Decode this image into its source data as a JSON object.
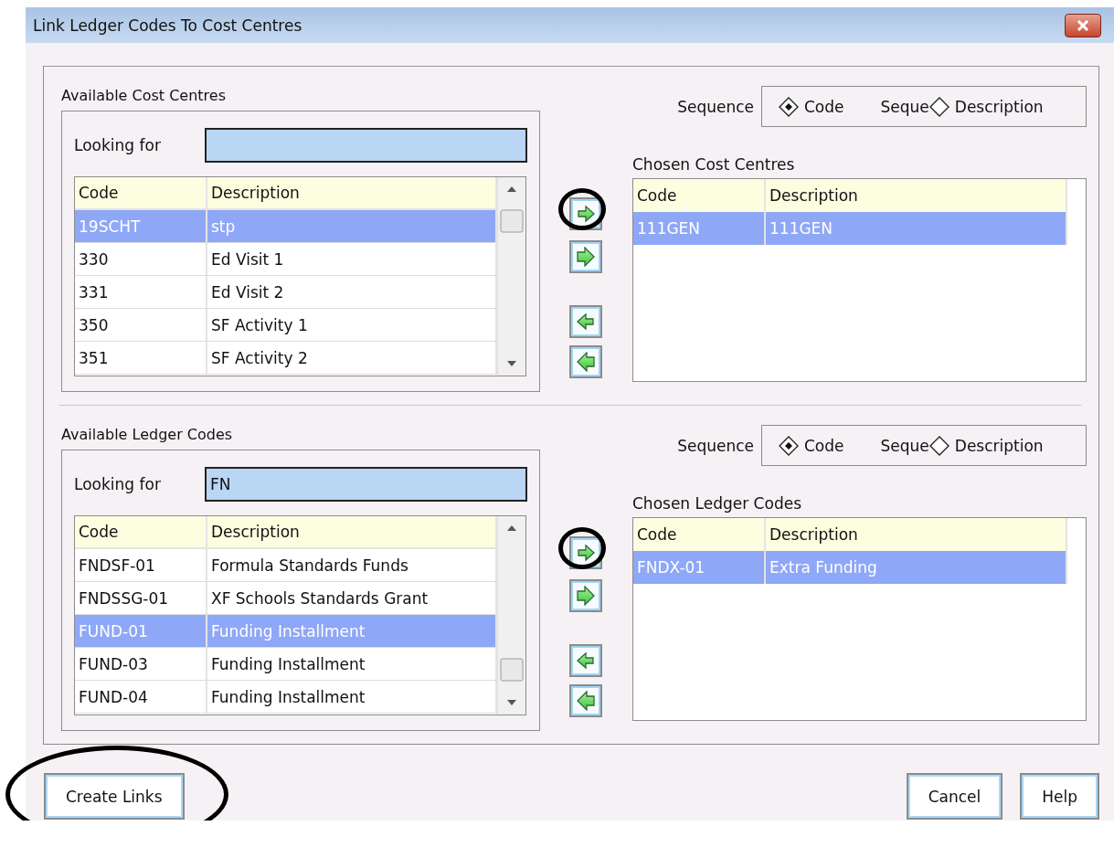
{
  "window": {
    "title": "Link Ledger Codes To Cost Centres"
  },
  "sections": [
    {
      "available": {
        "title": "Available Cost Centres",
        "search": {
          "label": "Looking for"
        },
        "columns": [
          "Code",
          "Description"
        ],
        "scrolled_down": false,
        "rows": [
          {
            "code": "19SCHT",
            "description": "stp",
            "selected": true
          },
          {
            "code": "330",
            "description": "Ed Visit 1",
            "selected": false
          },
          {
            "code": "331",
            "description": "Ed Visit 2",
            "selected": false
          },
          {
            "code": "350",
            "description": "SF Activity 1",
            "selected": false
          },
          {
            "code": "351",
            "description": "SF Activity 2",
            "selected": false
          }
        ]
      },
      "transfer_buttons": [
        {
          "kind": "add",
          "circled": true
        },
        {
          "kind": "add-all",
          "circled": false
        },
        {
          "kind": "remove",
          "circled": false
        },
        {
          "kind": "remove-all",
          "circled": false
        }
      ],
      "sequence": {
        "label": "Sequence",
        "clipped_label": "Seque",
        "options": [
          {
            "label": "Code",
            "selected": true
          },
          {
            "label": "Description",
            "selected": false
          }
        ]
      },
      "chosen": {
        "title": "Chosen Cost Centres",
        "columns": [
          "Code",
          "Description"
        ],
        "rows": [
          {
            "code": "111GEN",
            "description": "111GEN",
            "selected": true
          }
        ]
      }
    },
    {
      "available": {
        "title": "Available Ledger Codes",
        "search": {
          "label": "Looking for",
          "value": "FN"
        },
        "columns": [
          "Code",
          "Description"
        ],
        "scrolled_down": true,
        "rows": [
          {
            "code": "FNDSF-01",
            "description": "Formula Standards Funds",
            "selected": false
          },
          {
            "code": "FNDSSG-01",
            "description": "XF Schools Standards Grant",
            "selected": false
          },
          {
            "code": "FUND-01",
            "description": "Funding Installment",
            "selected": true
          },
          {
            "code": "FUND-03",
            "description": "Funding Installment",
            "selected": false
          },
          {
            "code": "FUND-04",
            "description": "Funding Installment",
            "selected": false
          }
        ]
      },
      "transfer_buttons": [
        {
          "kind": "add",
          "circled": true
        },
        {
          "kind": "add-all",
          "circled": false
        },
        {
          "kind": "remove",
          "circled": false
        },
        {
          "kind": "remove-all",
          "circled": false
        }
      ],
      "sequence": {
        "label": "Sequence",
        "clipped_label": "Seque",
        "options": [
          {
            "label": "Code",
            "selected": true
          },
          {
            "label": "Description",
            "selected": false
          }
        ]
      },
      "chosen": {
        "title": "Chosen Ledger Codes",
        "columns": [
          "Code",
          "Description"
        ],
        "rows": [
          {
            "code": "FNDX-01",
            "description": "Extra Funding",
            "selected": true
          }
        ]
      }
    }
  ],
  "left_buttons": [
    {
      "label": "Create Links",
      "circled": true
    }
  ],
  "right_buttons": [
    {
      "label": "Cancel",
      "circled": false
    },
    {
      "label": "Help",
      "circled": false
    }
  ]
}
